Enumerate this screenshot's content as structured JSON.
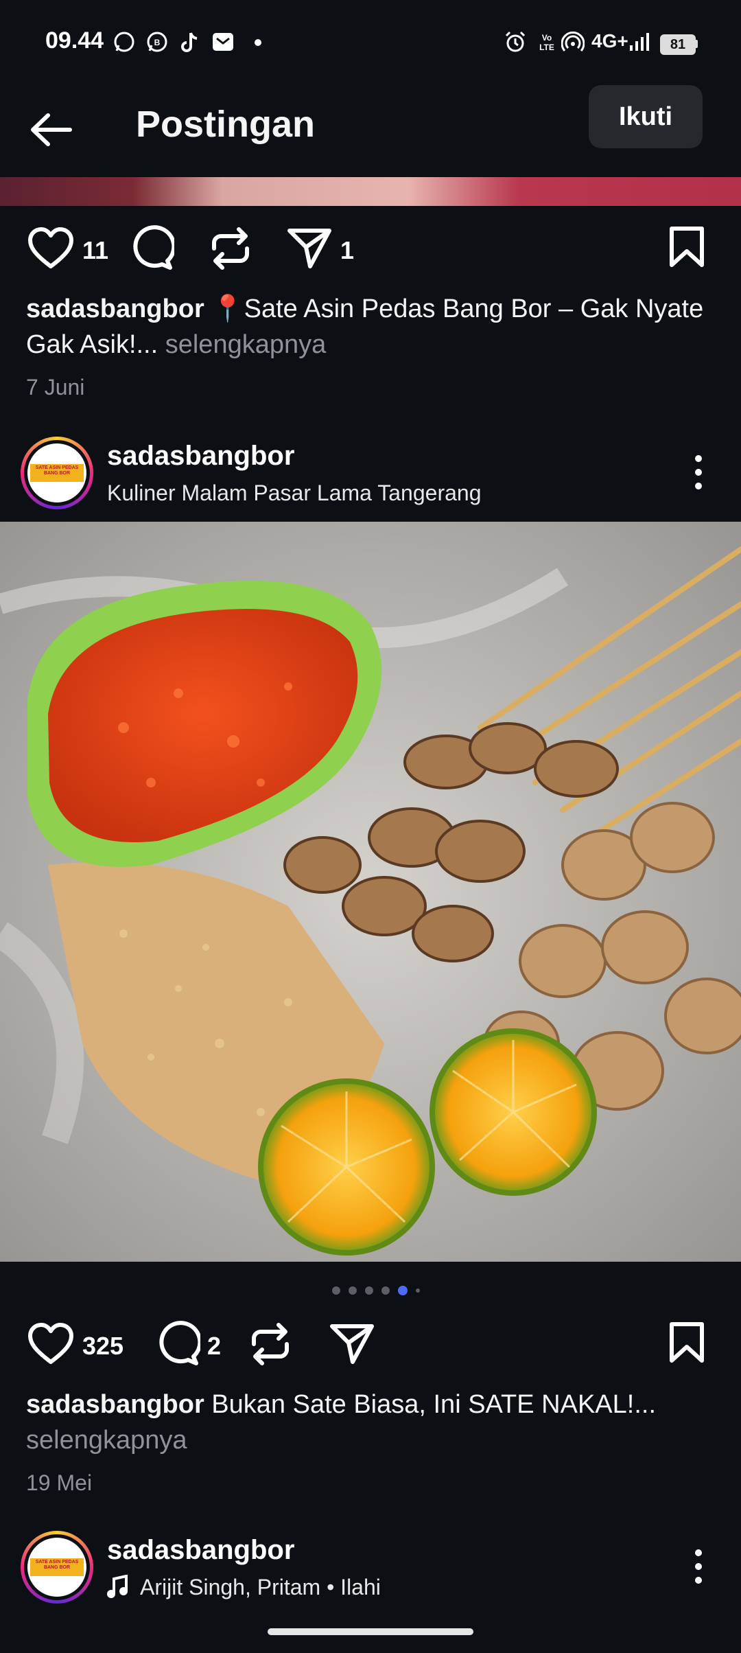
{
  "status_bar": {
    "time": "09.44",
    "network": "4G+",
    "battery": "81",
    "left_icons": [
      "whatsapp-icon",
      "whatsapp-business-icon",
      "tiktok-icon",
      "mail-icon",
      "dot-icon"
    ],
    "right_icons": [
      "alarm-icon",
      "volte-icon",
      "hotspot-icon",
      "signal-icon",
      "battery-icon"
    ]
  },
  "header": {
    "title": "Postingan",
    "follow_label": "Ikuti"
  },
  "post1": {
    "likes": "11",
    "shares": "1",
    "username": "sadasbangbor",
    "caption": " 📍Sate Asin Pedas Bang Bor – Gak Nyate Gak Asik!...",
    "more": " selengkapnya",
    "date": "7 Juni"
  },
  "post2": {
    "username": "sadasbangbor",
    "location": "Kuliner Malam Pasar Lama Tangerang",
    "avatar_logo_text": "SATE ASIN PEDAS BANG BOR",
    "likes": "325",
    "comments": "2",
    "caption_user": "sadasbangbor",
    "caption": " Bukan Sate Biasa, Ini SATE NAKAL!...",
    "more": "selengkapnya",
    "date": "19 Mei",
    "carousel_active_index": 4,
    "carousel_count": 6
  },
  "post3": {
    "username": "sadasbangbor",
    "music": "Arijit Singh, Pritam • Ilahi"
  },
  "colors": {
    "background": "#0c1014",
    "muted_text": "#8e9399",
    "active_dot": "#4f6bf5",
    "button_bg": "#25292e"
  }
}
